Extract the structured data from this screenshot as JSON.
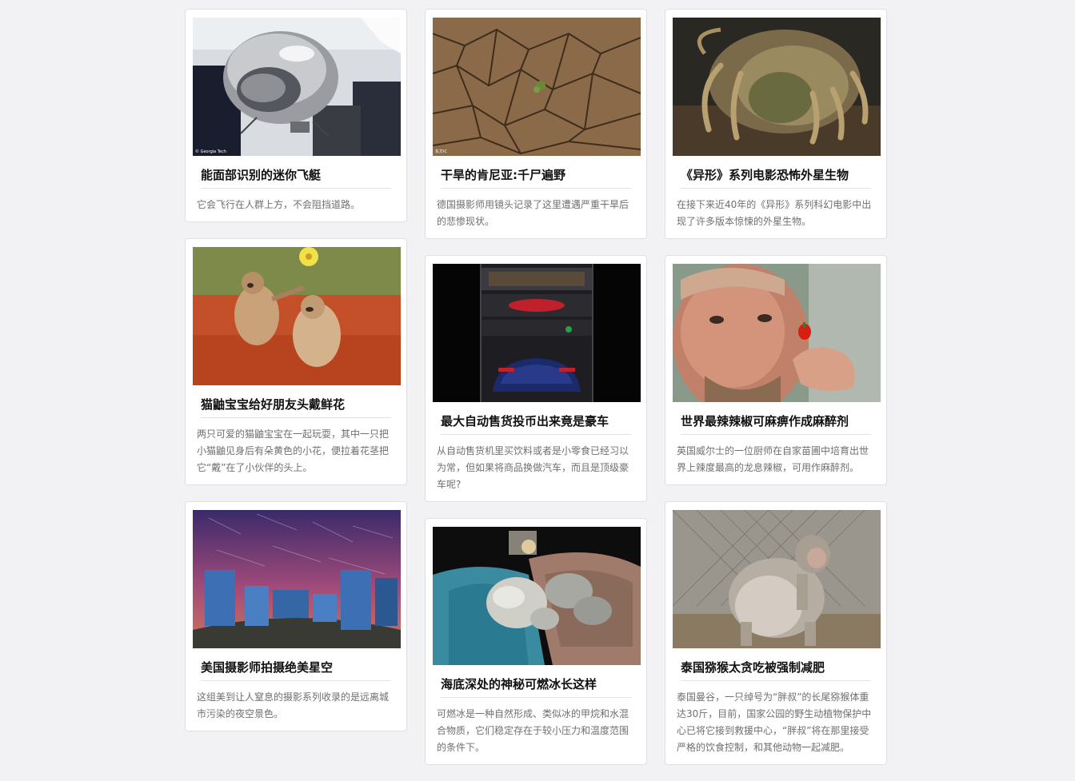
{
  "columns": [
    [
      {
        "title": "能面部识别的迷你飞艇",
        "desc": "它会飞行在人群上方，不会阻挡道路。",
        "image": "silver-balloon-drone",
        "credit": "© Georgia Tech"
      },
      {
        "title": "猫鼬宝宝给好朋友头戴鲜花",
        "desc": "两只可爱的猫鼬宝宝在一起玩耍，其中一只把小猫鼬见身后有朵黄色的小花，便拉着花茎把它“戴”在了小伙伴的头上。",
        "image": "baby-meerkats-flower"
      },
      {
        "title": "美国摄影师拍摄绝美星空",
        "desc": "这组美到让人窒息的摄影系列收录的是远离城市污染的夜空景色。",
        "image": "star-trails-carhenge"
      }
    ],
    [
      {
        "title": "干旱的肯尼亚:千尸遍野",
        "desc": "德国摄影师用镜头记录了这里遭遇严重干旱后的悲惨现状。",
        "image": "cracked-dry-earth",
        "credit": "东方IC"
      },
      {
        "title": "最大自动售货投币出来竟是豪车",
        "desc": "从自动售货机里买饮料或者是小零食已经习以为常，但如果将商品换做汽车，而且是顶级豪车呢?",
        "image": "car-vending-tower"
      },
      {
        "title": "海底深处的神秘可燃冰长这样",
        "desc": "可燃冰是一种自然形成、类似冰的甲烷和水混合物质，它们稳定存在于较小压力和温度范围的条件下。",
        "image": "methane-ice-in-hands"
      }
    ],
    [
      {
        "title": "《异形》系列电影恐怖外星生物",
        "desc": "在接下来近40年的《异形》系列科幻电影中出现了许多版本惊悚的外星生物。",
        "image": "alien-facehugger"
      },
      {
        "title": "世界最辣辣椒可麻痹作成麻醉剂",
        "desc": "英国威尔士的一位厨师在自家苗圃中培育出世界上辣度最高的龙息辣椒，可用作麻醉剂。",
        "image": "man-holding-red-chili"
      },
      {
        "title": "泰国猕猴太贪吃被强制减肥",
        "desc": "泰国曼谷，一只绰号为“胖叔”的长尾猕猴体重达30斤，目前，国家公园的野生动植物保护中心已将它接到救援中心，“胖叔”将在那里接受严格的饮食控制，和其他动物一起减肥。",
        "image": "fat-macaque"
      }
    ]
  ]
}
